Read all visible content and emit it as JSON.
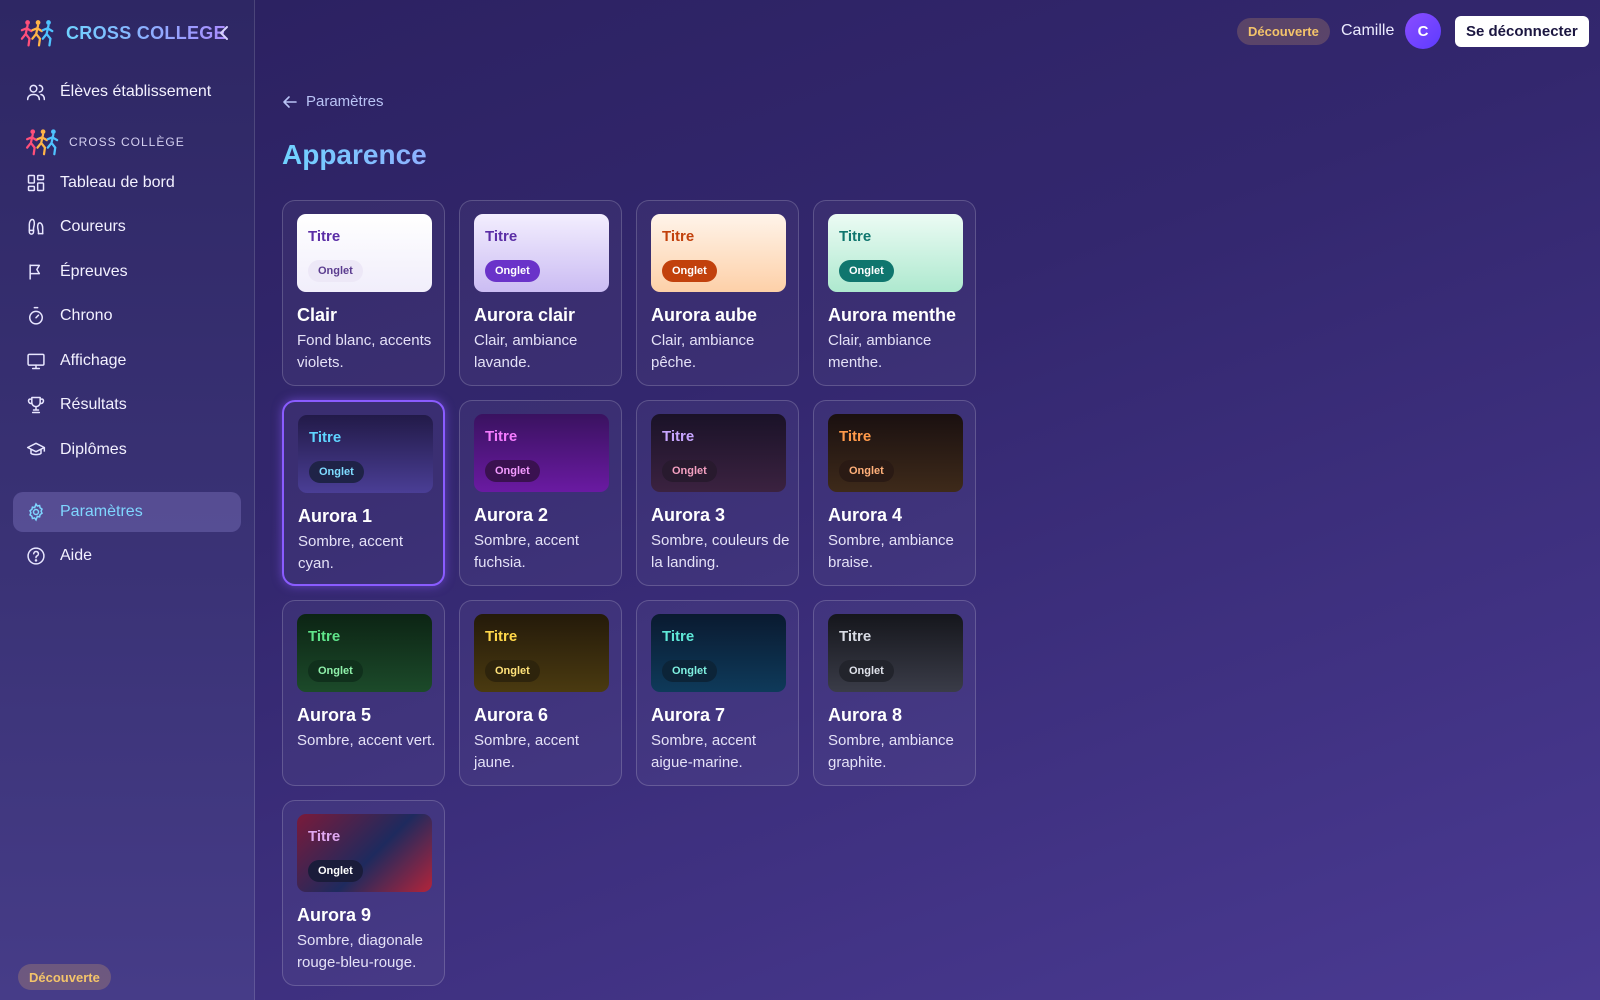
{
  "app": {
    "brand": "CROSS COLLEGE"
  },
  "sidebar": {
    "top_item": "Élèves établissement",
    "section_label": "CROSS COLLÈGE",
    "items": [
      {
        "label": "Tableau de bord",
        "icon": "dashboard-icon"
      },
      {
        "label": "Coureurs",
        "icon": "footprints-icon"
      },
      {
        "label": "Épreuves",
        "icon": "flag-icon"
      },
      {
        "label": "Chrono",
        "icon": "stopwatch-icon"
      },
      {
        "label": "Affichage",
        "icon": "monitor-icon"
      },
      {
        "label": "Résultats",
        "icon": "trophy-icon"
      },
      {
        "label": "Diplômes",
        "icon": "graduation-cap-icon"
      }
    ],
    "settings_label": "Paramètres",
    "help_label": "Aide",
    "bottom_badge": "Découverte"
  },
  "header": {
    "badge": "Découverte",
    "user_name": "Camille",
    "avatar_initial": "C",
    "logout_label": "Se déconnecter"
  },
  "main": {
    "back_label": "Paramètres",
    "title": "Apparence",
    "themes": [
      {
        "name": "Clair",
        "desc": "Fond blanc, accents violets.",
        "preview_title": "Titre",
        "preview_tab": "Onglet",
        "bg": "linear-gradient(180deg,#ffffff,#f1eefb)",
        "title_color": "#5b2ea6",
        "tab_bg": "#ede8f7",
        "tab_color": "#5b3c8f",
        "selected": false
      },
      {
        "name": "Aurora clair",
        "desc": "Clair, ambiance lavande.",
        "preview_title": "Titre",
        "preview_tab": "Onglet",
        "bg": "linear-gradient(180deg,#f3eefe,#cbbcf3)",
        "title_color": "#5b2ea6",
        "tab_bg": "#6a33c9",
        "tab_color": "#ffffff",
        "selected": false
      },
      {
        "name": "Aurora aube",
        "desc": "Clair, ambiance pêche.",
        "preview_title": "Titre",
        "preview_tab": "Onglet",
        "bg": "linear-gradient(180deg,#fff4ea,#fdd0a8)",
        "title_color": "#c2410c",
        "tab_bg": "#c2410c",
        "tab_color": "#ffffff",
        "selected": false
      },
      {
        "name": "Aurora menthe",
        "desc": "Clair, ambiance menthe.",
        "preview_title": "Titre",
        "preview_tab": "Onglet",
        "bg": "linear-gradient(180deg,#ecfbf4,#aee9cf)",
        "title_color": "#0f766e",
        "tab_bg": "#0f766e",
        "tab_color": "#ffffff",
        "selected": false
      },
      {
        "name": "Aurora 1",
        "desc": "Sombre, accent cyan.",
        "preview_title": "Titre",
        "preview_tab": "Onglet",
        "bg": "linear-gradient(180deg,#221a48,#4a3e95)",
        "title_color": "#5fd4ff",
        "tab_bg": "#1f2347",
        "tab_color": "#7fdcff",
        "selected": true
      },
      {
        "name": "Aurora 2",
        "desc": "Sombre, accent fuchsia.",
        "preview_title": "Titre",
        "preview_tab": "Onglet",
        "bg": "linear-gradient(180deg,#3a1260,#6a1aa2)",
        "title_color": "#f57bff",
        "tab_bg": "#3a1150",
        "tab_color": "#f39bff",
        "selected": false
      },
      {
        "name": "Aurora 3",
        "desc": "Sombre, couleurs de la landing.",
        "preview_title": "Titre",
        "preview_tab": "Onglet",
        "bg": "linear-gradient(180deg,#1a1228,#3b2240)",
        "title_color": "#c8a6ff",
        "tab_bg": "#281a2e",
        "tab_color": "#f3a0c0",
        "selected": false
      },
      {
        "name": "Aurora 4",
        "desc": "Sombre, ambiance braise.",
        "preview_title": "Titre",
        "preview_tab": "Onglet",
        "bg": "linear-gradient(180deg,#1a1010,#3e2a1a)",
        "title_color": "#ff9a4a",
        "tab_bg": "#2a1a14",
        "tab_color": "#ffb07a",
        "selected": false
      },
      {
        "name": "Aurora 5",
        "desc": "Sombre, accent vert.",
        "preview_title": "Titre",
        "preview_tab": "Onglet",
        "bg": "linear-gradient(180deg,#0c2414,#1c4a2a)",
        "title_color": "#5fe38a",
        "tab_bg": "#10301c",
        "tab_color": "#8ff0aa",
        "selected": false
      },
      {
        "name": "Aurora 6",
        "desc": "Sombre, accent jaune.",
        "preview_title": "Titre",
        "preview_tab": "Onglet",
        "bg": "linear-gradient(180deg,#241a0a,#4a3a10)",
        "title_color": "#ffd84a",
        "tab_bg": "#2e240c",
        "tab_color": "#ffe27a",
        "selected": false
      },
      {
        "name": "Aurora 7",
        "desc": "Sombre, accent aigue-marine.",
        "preview_title": "Titre",
        "preview_tab": "Onglet",
        "bg": "linear-gradient(180deg,#0a1a30,#0e3a5a)",
        "title_color": "#5fe8d8",
        "tab_bg": "#0c2438",
        "tab_color": "#7ff0e0",
        "selected": false
      },
      {
        "name": "Aurora 8",
        "desc": "Sombre, ambiance graphite.",
        "preview_title": "Titre",
        "preview_tab": "Onglet",
        "bg": "linear-gradient(180deg,#15161c,#3a3c48)",
        "title_color": "#d8dbe4",
        "tab_bg": "#22242c",
        "tab_color": "#dfe2ea",
        "selected": false
      },
      {
        "name": "Aurora 9",
        "desc": "Sombre, diagonale rouge-bleu-rouge.",
        "preview_title": "Titre",
        "preview_tab": "Onglet",
        "bg": "linear-gradient(135deg,#7a1a3a 0%,#1e2a5e 55%,#b3243a 100%)",
        "title_color": "#e0a8f0",
        "tab_bg": "#1a1c3a",
        "tab_color": "#ffffff",
        "selected": false
      }
    ]
  }
}
